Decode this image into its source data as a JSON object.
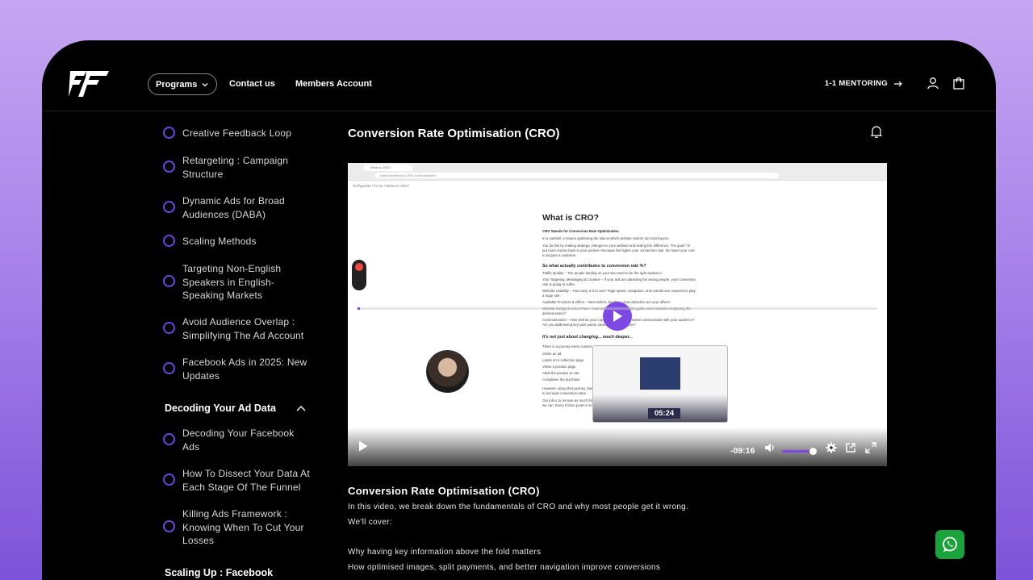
{
  "header": {
    "programs_label": "Programs",
    "contact_label": "Contact us",
    "members_label": "Members Account",
    "mentoring_label": "1-1 MENTORING"
  },
  "sidebar": {
    "lessons_a": [
      "Creative Feedback Loop",
      "Retargeting : Campaign Structure",
      "Dynamic Ads for Broad Audiences (DABA)",
      "Scaling Methods",
      "Targeting Non-English Speakers in English-Speaking Markets",
      "Avoid Audience Overlap : Simplifying The Ad Account",
      "Facebook Ads in 2025: New Updates"
    ],
    "section_decoding": "Decoding Your Ad Data",
    "lessons_b": [
      "Decoding Your Facebook Ads",
      "How To Dissect Your Data At Each Stage Of The Funnel",
      "Killing Ads Framework : Knowing When To Cut Your Losses"
    ],
    "section_scaling": "Scaling Up : Facebook"
  },
  "main": {
    "title": "Conversion Rate Optimisation (CRO)"
  },
  "video": {
    "browser_tab": "What is CRO?",
    "browser_url": "notion.so/What-is-CRO-1e0d1c8c9e89",
    "breadcrumb": "ToThgunter / To do / What is CRO?",
    "doc_heading": "What is CRO?",
    "doc_intro_title": "CRO Stands for Conversion Rate Optimisation",
    "doc_intro_1": "In a nutshell, it means optimising the rate at which website visitors turn into buyers.",
    "doc_intro_2": "You do this by making strategic changes to your website and testing the difference. The goal? To put more money back in your pocket—because the higher your conversion rate, the lower your cost to acquire a customer.",
    "doc_subhead": "So what actually contributes to conversion rate %?",
    "doc_bullets": [
      "Traffic Quality – The people landing on your site need to be the right audience.",
      "Your Targeting, Messaging & Creative – If your ads are attracting the wrong people, your conversion rate is going to suffer.",
      "Website Usability – How easy is it to use? Page speed, navigation, and overall user experience play a huge role.",
      "Available Products & Offers – Best sellers, bundles—how attractive are your offers?",
      "Website Design & Action Flow – How well does your website guide users towards completing the desired action?",
      "Communication – How well do your copy, branding, and creative communicate with your audience? Are you addressing key pain points, desires, and objections?"
    ],
    "doc_italic": "It's not just about changing... much deeper...",
    "doc_journey": "There is a journey every custom...",
    "doc_steps": [
      "Clicks an ad",
      "Lands on a collection page",
      "Views a product page",
      "Adds the product to cart",
      "Completes the purchase"
    ],
    "doc_outro_1": "However, along that journey, there are many key friction points that we need to identify and address to increase conversion rates.",
    "doc_outro_2": "Our job is to remove as much friction as possible and make the customer journey as seamless as we can. Every friction point is money left on the table.",
    "thumb_time": "05:24",
    "remaining_time": "-09:16",
    "progress": 0.003,
    "volume": 0.9
  },
  "content": {
    "title": "Conversion Rate Optimisation (CRO)",
    "intro": "In this video, we break down the fundamentals of CRO and why most people get it wrong.",
    "cover": "We'll cover:",
    "points": [
      "Why having key information above the fold matters",
      "How optimised images, split payments, and better navigation improve conversions"
    ]
  },
  "colors": {
    "accent": "#7d48e6",
    "ring": "#6b46e0",
    "whatsapp": "#1aa33b"
  },
  "icons": [
    "logo-icon",
    "chevron-down-icon",
    "arrow-right-icon",
    "user-icon",
    "bag-icon",
    "bell-icon",
    "play-icon",
    "volume-icon",
    "settings-icon",
    "pip-icon",
    "fullscreen-icon",
    "whatsapp-icon"
  ]
}
